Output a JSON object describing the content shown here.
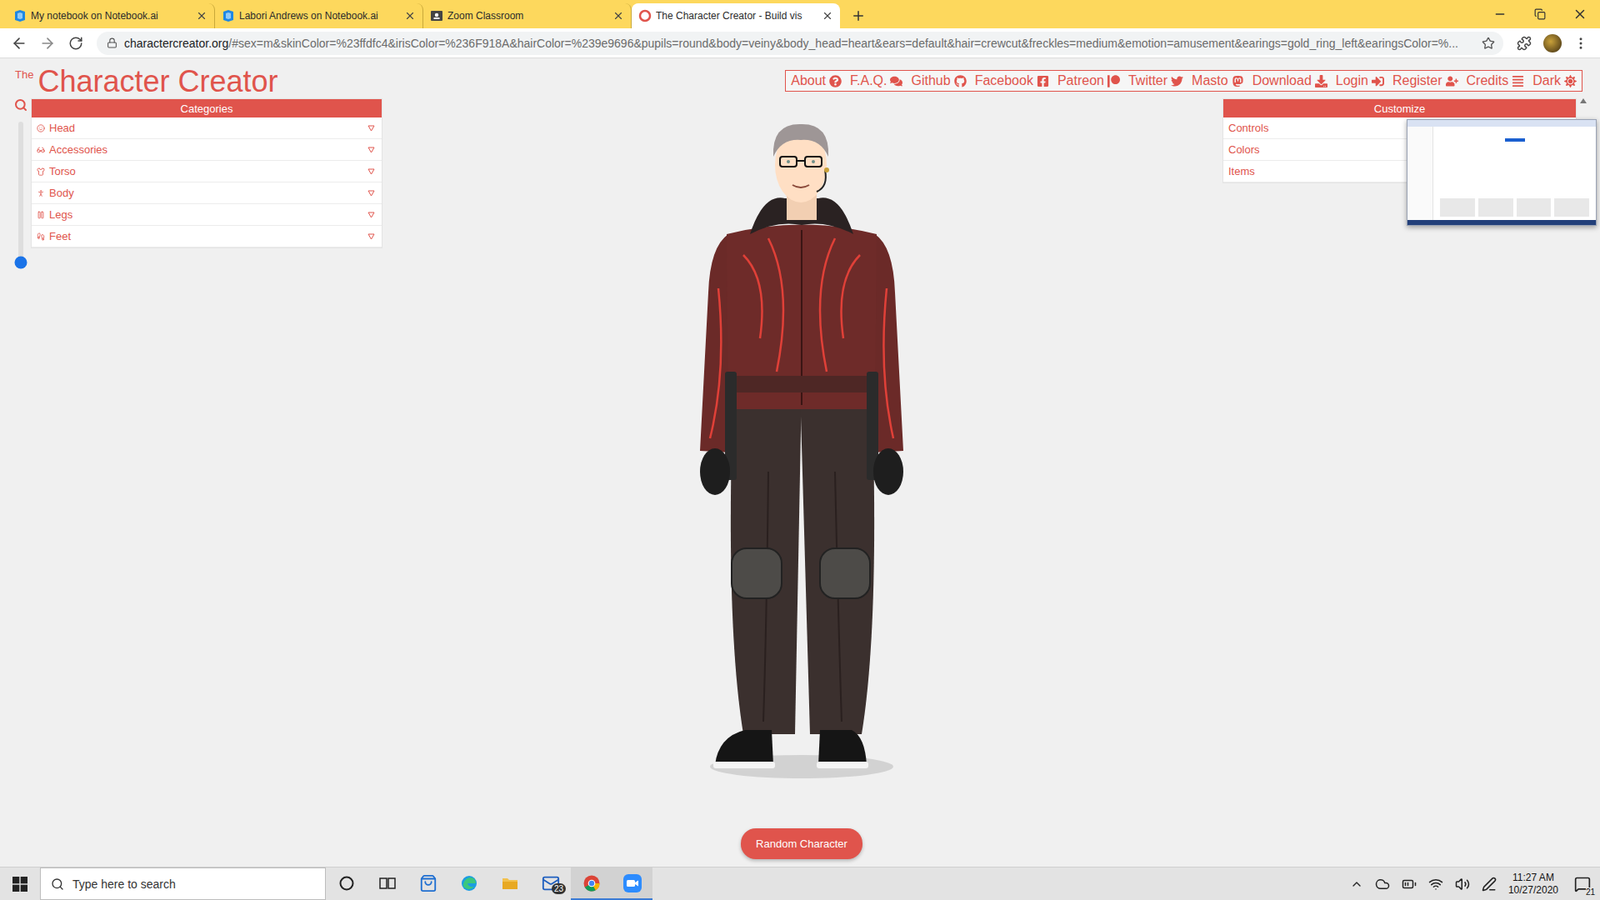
{
  "browser": {
    "tabs": [
      {
        "title": "My notebook on Notebook.ai",
        "kind": "notebook",
        "selected": false
      },
      {
        "title": "Labori Andrews on Notebook.ai",
        "kind": "notebook",
        "selected": false
      },
      {
        "title": "Zoom Classroom",
        "kind": "classroom",
        "selected": false
      },
      {
        "title": "The Character Creator - Build vis",
        "kind": "charactercreator",
        "selected": true
      }
    ],
    "address_bar": {
      "host": "charactercreator.org",
      "path": "/#sex=m&skinColor=%23ffdfc4&irisColor=%236F918A&hairColor=%239e9696&pupils=round&body=veiny&body_head=heart&ears=default&hair=crewcut&freckles=medium&emotion=amusement&earings=gold_ring_left&earingsColor=%..."
    }
  },
  "page": {
    "logo_prefix": "The",
    "logo": "Character Creator",
    "nav": [
      "About",
      "F.A.Q.",
      "Github",
      "Facebook",
      "Patreon",
      "Twitter",
      "Masto",
      "Download",
      "Login",
      "Register",
      "Credits",
      "Dark"
    ],
    "zoom_slider": {
      "level": 0
    },
    "categories": {
      "title": "Categories",
      "items": [
        {
          "label": "Head",
          "expanded": false
        },
        {
          "label": "Accessories",
          "expanded": false
        },
        {
          "label": "Torso",
          "expanded": false
        },
        {
          "label": "Body",
          "expanded": false
        },
        {
          "label": "Legs",
          "expanded": false
        },
        {
          "label": "Feet",
          "expanded": false
        }
      ]
    },
    "customize": {
      "title": "Customize",
      "items": [
        "Controls",
        "Colors",
        "Items"
      ]
    },
    "random_button": "Random Character"
  },
  "taskbar": {
    "search_placeholder": "Type here to search",
    "apps": [
      {
        "kind": "cortana",
        "active": false
      },
      {
        "kind": "task-view",
        "active": false
      },
      {
        "kind": "store",
        "active": false
      },
      {
        "kind": "edge",
        "active": false
      },
      {
        "kind": "explorer",
        "active": false
      },
      {
        "kind": "mail",
        "active": false,
        "badge": "23"
      },
      {
        "kind": "chrome",
        "active": true
      },
      {
        "kind": "zoom",
        "active": true
      }
    ],
    "clock": {
      "time": "11:27 AM",
      "date": "10/27/2020"
    },
    "notifications": "21"
  }
}
